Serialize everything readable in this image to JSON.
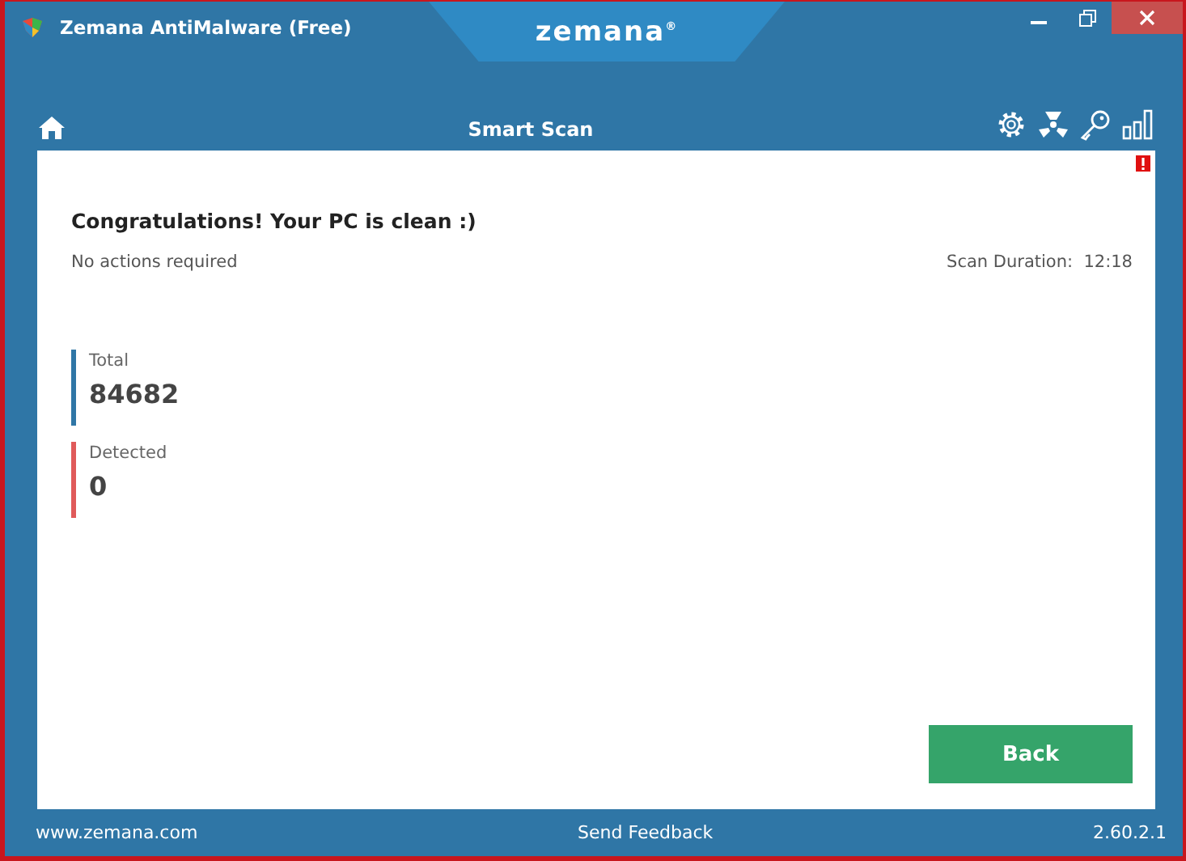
{
  "window": {
    "title": "Zemana AntiMalware (Free)",
    "logo": "zemana",
    "logo_mark": "®"
  },
  "toolbar": {
    "title": "Smart Scan"
  },
  "result": {
    "heading": "Congratulations! Your PC is clean :)",
    "subtitle": "No actions required",
    "duration": "Scan Duration:  12:18"
  },
  "stats": [
    {
      "label": "Total",
      "value": "84682",
      "color": "#2f76a6"
    },
    {
      "label": "Detected",
      "value": "0",
      "color": "#e05a5a"
    }
  ],
  "back_button": "Back",
  "footer": {
    "website": "www.zemana.com",
    "feedback": "Send Feedback",
    "version": "2.60.2.1"
  }
}
